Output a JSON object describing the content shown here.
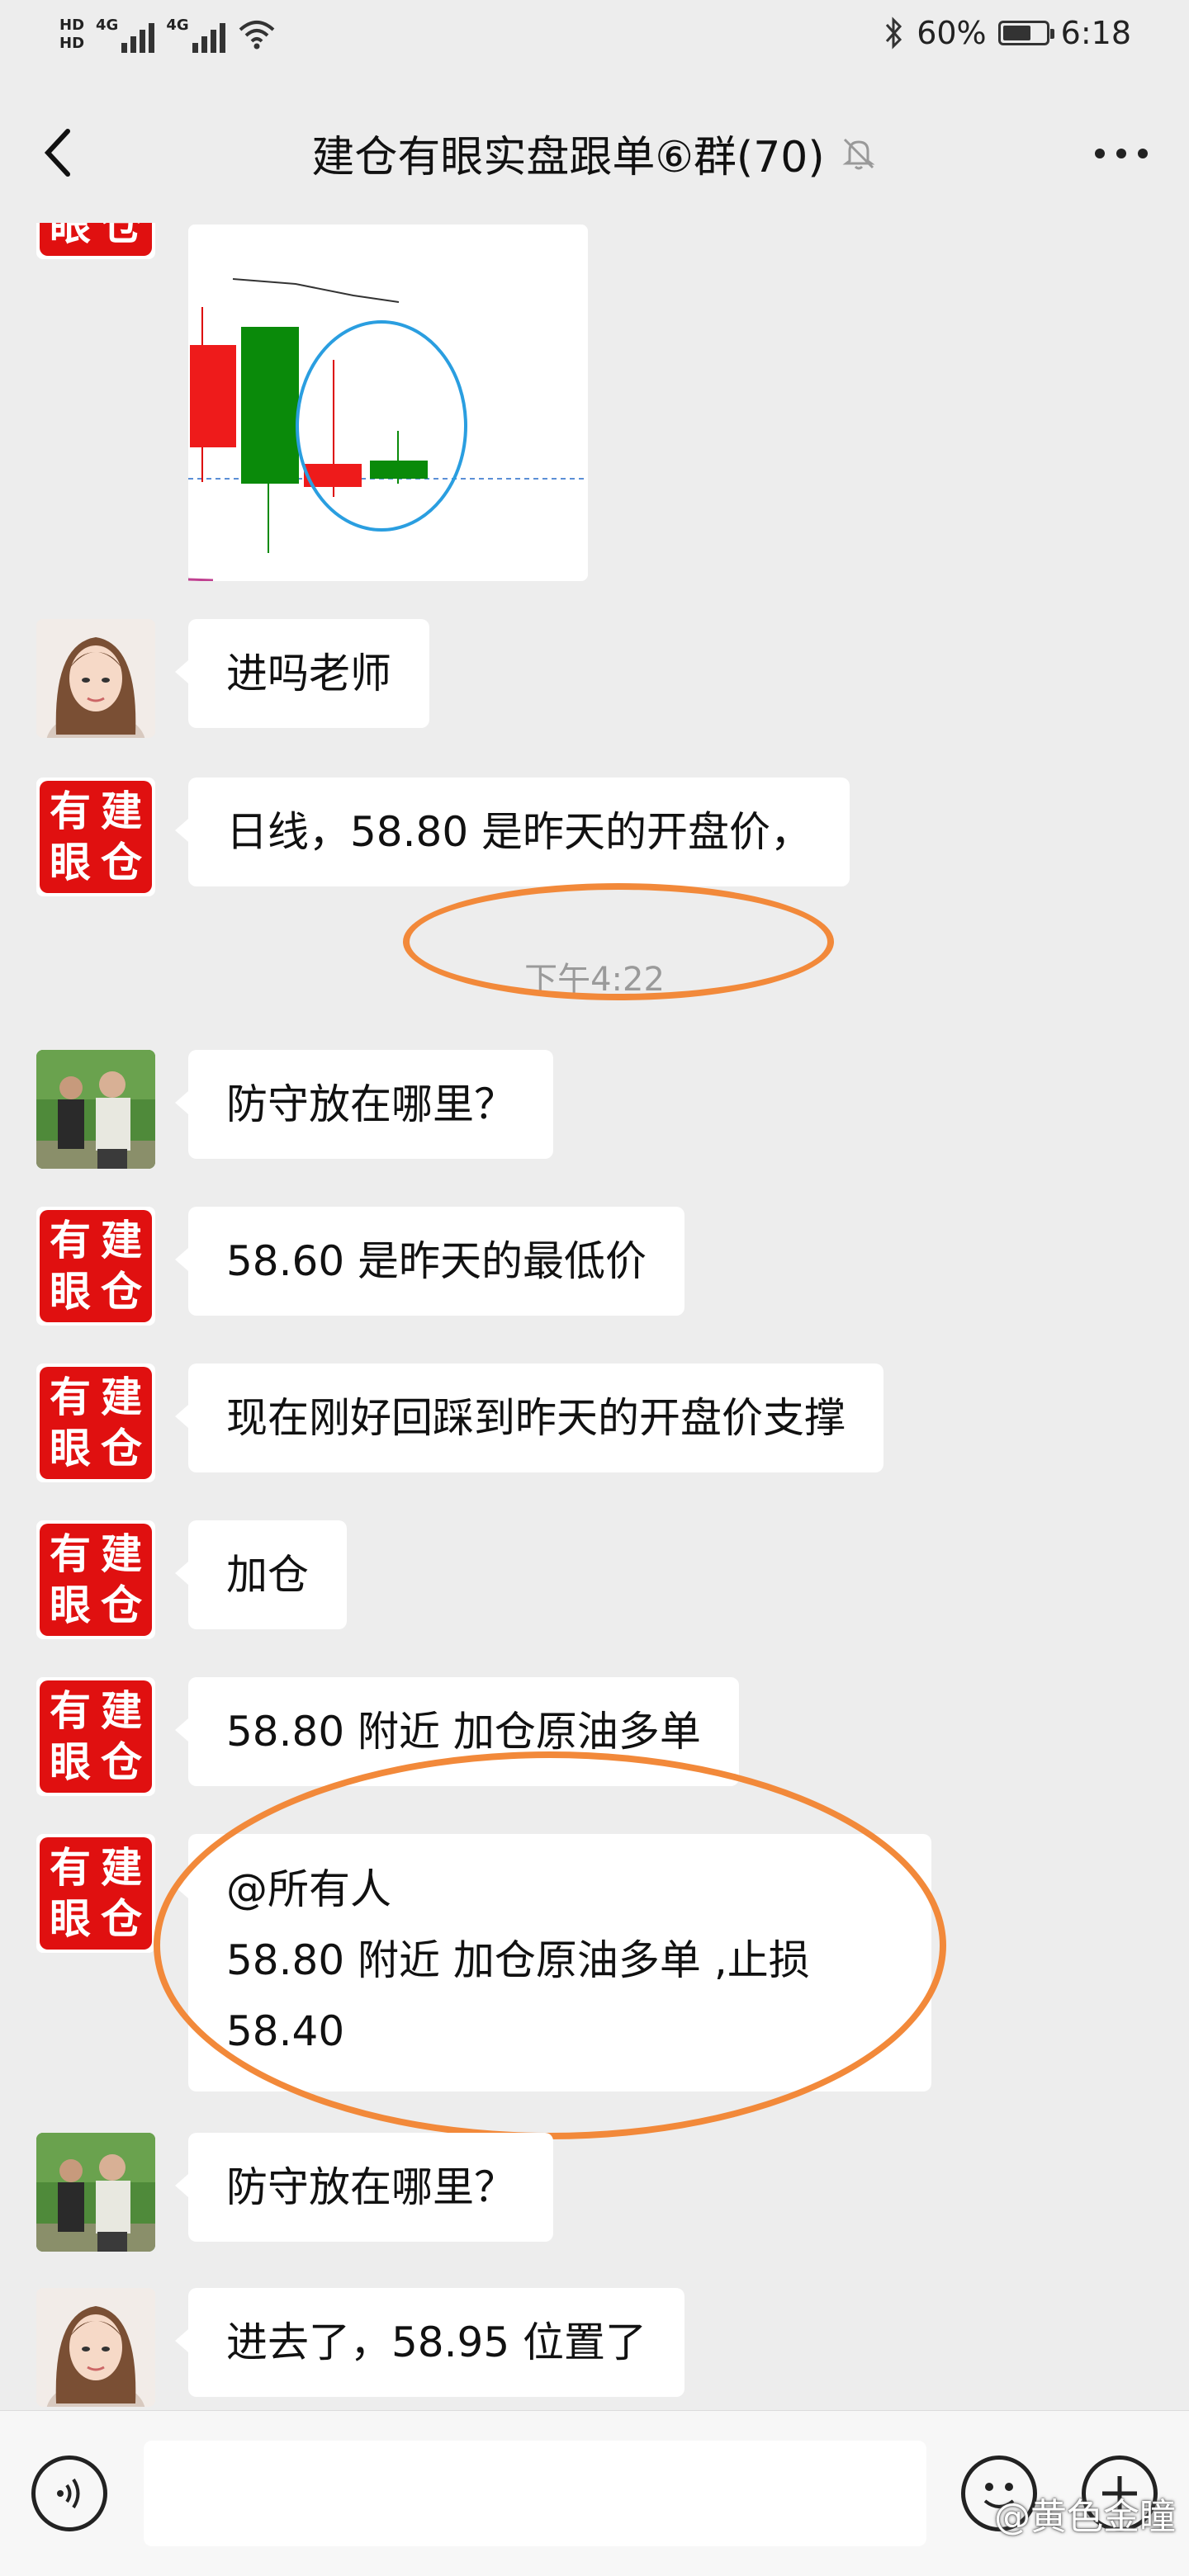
{
  "status_bar": {
    "hd_top": "HD",
    "hd_bottom": "HD",
    "sig1_label": "4G",
    "sig2_label": "4G",
    "battery_text": "60%",
    "time": "6:18"
  },
  "header": {
    "title": "建仓有眼实盘跟单⑥群(70)",
    "back_icon": "chevron-left-icon",
    "mute_icon": "bell-off-icon",
    "more_icon": "more-dots-icon"
  },
  "brand_logo": {
    "chars": [
      "有",
      "建",
      "眼",
      "仓"
    ],
    "color": "#e01010"
  },
  "messages": [
    {
      "sender": "girl",
      "text": "进吗老师"
    },
    {
      "sender": "logo",
      "text": "日线，58.80 是昨天的开盘价，"
    },
    {
      "sender": "men",
      "text": "防守放在哪里？"
    },
    {
      "sender": "logo",
      "text": "58.60 是昨天的最低价"
    },
    {
      "sender": "logo",
      "text": "现在刚好回踩到昨天的开盘价支撑"
    },
    {
      "sender": "logo",
      "text": "加仓"
    },
    {
      "sender": "logo",
      "text": "58.80 附近 加仓原油多单"
    },
    {
      "sender": "logo",
      "lines": [
        "@所有人",
        "58.80 附近 加仓原油多单 ,止损",
        "58.40"
      ]
    },
    {
      "sender": "men",
      "text": "防守放在哪里？"
    },
    {
      "sender": "girl",
      "text": "进去了，58.95 位置了"
    }
  ],
  "timestamp": "下午4:22",
  "annotation_color": "#f2893a",
  "input_bar": {
    "voice_icon": "voice-icon",
    "emoji_icon": "emoji-icon",
    "plus_icon": "plus-icon"
  },
  "watermark": "@黄色金瞳"
}
